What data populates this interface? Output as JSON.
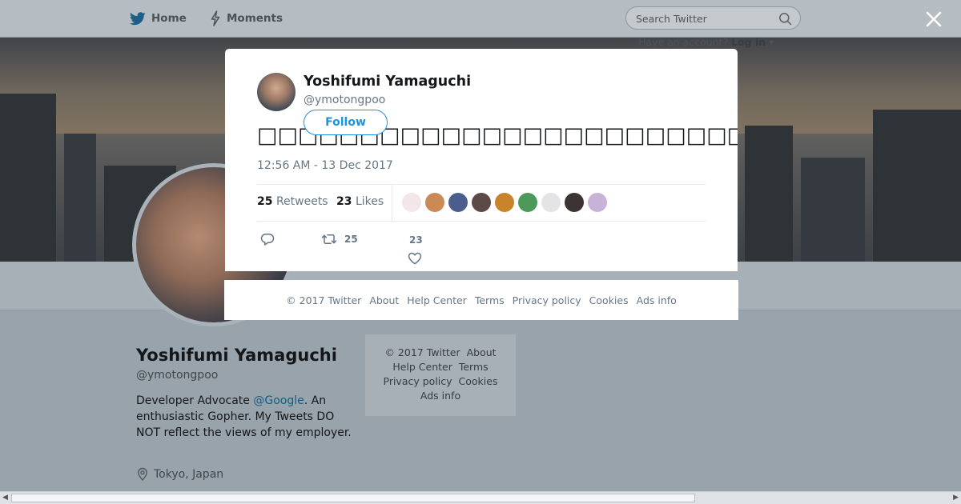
{
  "nav": {
    "home_label": "Home",
    "moments_label": "Moments",
    "search_placeholder": "Search Twitter",
    "login_prompt": "Have an account?",
    "login_label": "Log in",
    "login_caret": "▾"
  },
  "profile": {
    "name": "Yoshifumi Yamaguchi",
    "handle": "@ymotongpoo",
    "bio_prefix": "Developer Advocate ",
    "bio_link": "@Google",
    "bio_suffix": ". An enthusiastic Gopher. My Tweets DO NOT reflect the views of my employer.",
    "location": "Tokyo, Japan"
  },
  "side_footer": {
    "copyright": "© 2017 Twitter",
    "about": "About",
    "help": "Help Center",
    "terms": "Terms",
    "privacy": "Privacy policy",
    "cookies": "Cookies",
    "ads": "Ads info"
  },
  "tweet": {
    "name": "Yoshifumi Yamaguchi",
    "handle": "@ymotongpoo",
    "follow_label": "Follow",
    "text": "□□□□□□□□□□□□□□□□□□□□□□□□□□□□□□□□□□□□□□□□□□□□□□□□□□□□□□□□□",
    "date": "12:56 AM - 13 Dec 2017",
    "retweets_count": "25",
    "retweets_label": "Retweets",
    "likes_count": "23",
    "likes_label": "Likes",
    "reply_count": "",
    "retweet_action_count": "25",
    "like_action_count": "23",
    "liker_colors": [
      "#f3e6e8",
      "#c98a55",
      "#4a5d8c",
      "#5b4a48",
      "#c9832a",
      "#4b9a5a",
      "#e4e4e6",
      "#3b3433",
      "#c9b2d8"
    ]
  },
  "modal_footer": {
    "copyright": "© 2017 Twitter",
    "about": "About",
    "help": "Help Center",
    "terms": "Terms",
    "privacy": "Privacy policy",
    "cookies": "Cookies",
    "ads": "Ads info"
  },
  "colors": {
    "accent": "#1b95e0",
    "link": "#0e5f86",
    "muted": "#657786"
  }
}
